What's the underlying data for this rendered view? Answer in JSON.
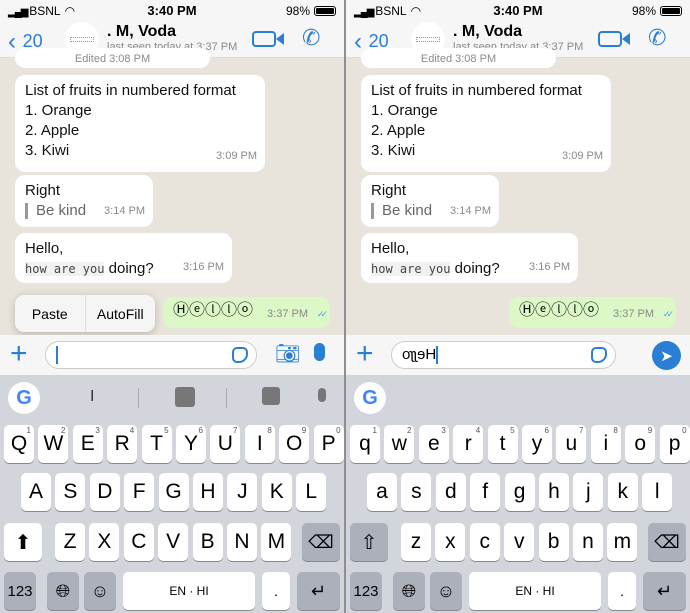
{
  "colors": {
    "accent": "#2a7fd4",
    "sent_bubble": "#dcf8c6",
    "chat_bg": "#e8e3db",
    "keyboard_bg": "#d2d5db"
  },
  "panels": [
    {
      "status": {
        "carrier": "BSNL",
        "time": "3:40 PM",
        "battery": "98%"
      },
      "header": {
        "back_count": "20",
        "name": ". M, Voda",
        "last_seen": "last seen today at 3:37 PM"
      },
      "messages": {
        "edited": "Edited 3:08 PM",
        "fruits": {
          "title": "List of fruits in numbered format",
          "items": [
            "1. Orange",
            "2. Apple",
            "3. Kiwi"
          ],
          "time": "3:09 PM"
        },
        "right": {
          "text": "Right",
          "quote": "Be kind",
          "time": "3:14 PM"
        },
        "hello": {
          "line1": "Hello,",
          "mono": "how are you",
          "rest": " doing?",
          "time": "3:16 PM"
        },
        "sent": {
          "text": "Ⓗⓔⓛⓛⓞ",
          "time": "3:37 PM",
          "ticks": "✓✓"
        }
      },
      "popup": {
        "paste": "Paste",
        "autofill": "AutoFill"
      },
      "input": {
        "value": ""
      },
      "suggestion": "I",
      "keyboard": {
        "rows": [
          [
            "Q",
            "W",
            "E",
            "R",
            "T",
            "Y",
            "U",
            "I",
            "O",
            "P"
          ],
          [
            "A",
            "S",
            "D",
            "F",
            "G",
            "H",
            "J",
            "K",
            "L"
          ],
          [
            "Z",
            "X",
            "C",
            "V",
            "B",
            "N",
            "M"
          ]
        ],
        "hints": [
          "1",
          "2",
          "3",
          "4",
          "5",
          "6",
          "7",
          "8",
          "9",
          "0"
        ],
        "numbers": "123",
        "space": "EN · HI",
        "period": ".",
        "shift_active": true
      }
    },
    {
      "status": {
        "carrier": "BSNL",
        "time": "3:40 PM",
        "battery": "98%"
      },
      "header": {
        "back_count": "20",
        "name": ". M, Voda",
        "last_seen": "last seen today at 3:37 PM"
      },
      "messages": {
        "edited": "Edited 3:08 PM",
        "fruits": {
          "title": "List of fruits in numbered format",
          "items": [
            "1. Orange",
            "2. Apple",
            "3. Kiwi"
          ],
          "time": "3:09 PM"
        },
        "right": {
          "text": "Right",
          "quote": "Be kind",
          "time": "3:14 PM"
        },
        "hello": {
          "line1": "Hello,",
          "mono": "how are you",
          "rest": " doing?",
          "time": "3:16 PM"
        },
        "sent": {
          "text": "Ⓗⓔⓛⓛⓞ",
          "time": "3:37 PM",
          "ticks": "✓✓"
        }
      },
      "input": {
        "value": "oʅʅɘH"
      },
      "suggestion": "",
      "keyboard": {
        "rows": [
          [
            "q",
            "w",
            "e",
            "r",
            "t",
            "y",
            "u",
            "i",
            "o",
            "p"
          ],
          [
            "a",
            "s",
            "d",
            "f",
            "g",
            "h",
            "j",
            "k",
            "l"
          ],
          [
            "z",
            "x",
            "c",
            "v",
            "b",
            "n",
            "m"
          ]
        ],
        "hints": [
          "1",
          "2",
          "3",
          "4",
          "5",
          "6",
          "7",
          "8",
          "9",
          "0"
        ],
        "numbers": "123",
        "space": "EN · HI",
        "period": ".",
        "shift_active": false
      }
    }
  ]
}
